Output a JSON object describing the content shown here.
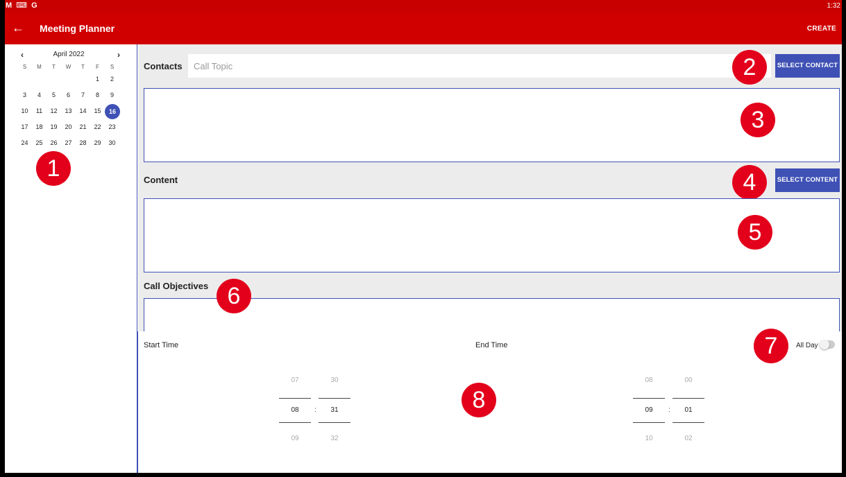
{
  "statusbar": {
    "icons": [
      "gmail-icon",
      "keyboard-icon",
      "google-icon"
    ],
    "icon_glyphs": [
      "M",
      "⌨",
      "G"
    ],
    "time": "1:32"
  },
  "appbar": {
    "title": "Meeting Planner",
    "create_label": "CREATE",
    "back_glyph": "←"
  },
  "calendar": {
    "month": "April 2022",
    "prev_glyph": "‹",
    "next_glyph": "›",
    "weekdays": [
      "S",
      "M",
      "T",
      "W",
      "T",
      "F",
      "S"
    ],
    "lead_blanks": 5,
    "days": [
      "1",
      "2",
      "3",
      "4",
      "5",
      "6",
      "7",
      "8",
      "9",
      "10",
      "11",
      "12",
      "13",
      "14",
      "15",
      "16",
      "17",
      "18",
      "19",
      "20",
      "21",
      "22",
      "23",
      "24",
      "25",
      "26",
      "27",
      "28",
      "29",
      "30"
    ],
    "selected_day": "16"
  },
  "contacts": {
    "label": "Contacts",
    "placeholder": "Call Topic",
    "button": "SELECT CONTACT"
  },
  "content": {
    "label": "Content",
    "button": "SELECT CONTENT"
  },
  "objectives": {
    "label": "Call Objectives"
  },
  "time": {
    "start_label": "Start Time",
    "end_label": "End Time",
    "all_day_label": "All Day",
    "all_day_on": false,
    "start_hour": {
      "prev": "07",
      "cur": "08",
      "next": "09"
    },
    "start_min": {
      "prev": "30",
      "cur": "31",
      "next": "32"
    },
    "end_hour": {
      "prev": "08",
      "cur": "09",
      "next": "10"
    },
    "end_min": {
      "prev": "00",
      "cur": "01",
      "next": "02"
    },
    "separator": ":"
  },
  "badges": [
    "1",
    "2",
    "3",
    "4",
    "5",
    "6",
    "7",
    "8"
  ],
  "colors": {
    "appbar": "#d10000",
    "statusbar": "#c90000",
    "accent": "#3f51b5",
    "badge": "#e3001b"
  }
}
